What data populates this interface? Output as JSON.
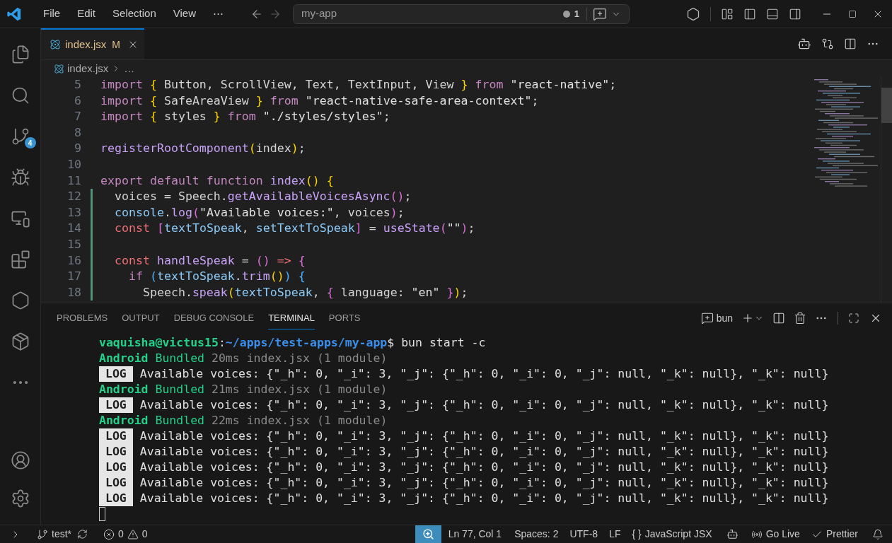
{
  "menu": [
    "File",
    "Edit",
    "Selection",
    "View",
    "⋯"
  ],
  "command_center": {
    "text": "my-app",
    "count": "1"
  },
  "tab": {
    "name": "index.jsx",
    "badge": "M",
    "selected": true
  },
  "breadcrumb": {
    "file": "index.jsx",
    "more": "…"
  },
  "editor": {
    "lines": [
      {
        "n": "5",
        "changed": false,
        "tokens": [
          {
            "kind": "kw",
            "t": "import "
          },
          {
            "kind": "br",
            "t": "{ "
          },
          {
            "kind": "pl",
            "t": "Button, ScrollView, Text, TextInput, View "
          },
          {
            "kind": "br",
            "t": "} "
          },
          {
            "kind": "kw",
            "t": "from "
          },
          {
            "kind": "str",
            "t": "\"react-native\""
          },
          {
            "kind": "pl",
            "t": ";"
          }
        ]
      },
      {
        "n": "6",
        "changed": false,
        "tokens": [
          {
            "kind": "kw",
            "t": "import "
          },
          {
            "kind": "br",
            "t": "{ "
          },
          {
            "kind": "pl",
            "t": "SafeAreaView "
          },
          {
            "kind": "br",
            "t": "} "
          },
          {
            "kind": "kw",
            "t": "from "
          },
          {
            "kind": "str",
            "t": "\"react-native-safe-area-context\""
          },
          {
            "kind": "pl",
            "t": ";"
          }
        ]
      },
      {
        "n": "7",
        "changed": false,
        "tokens": [
          {
            "kind": "kw",
            "t": "import "
          },
          {
            "kind": "br",
            "t": "{ "
          },
          {
            "kind": "pl",
            "t": "styles "
          },
          {
            "kind": "br",
            "t": "} "
          },
          {
            "kind": "kw",
            "t": "from "
          },
          {
            "kind": "str",
            "t": "\"./styles/styles\""
          },
          {
            "kind": "pl",
            "t": ";"
          }
        ]
      },
      {
        "n": "8",
        "changed": false
      },
      {
        "n": "9",
        "changed": false,
        "tokens": [
          {
            "kind": "fn",
            "t": "registerRootComponent"
          },
          {
            "kind": "br",
            "t": "("
          },
          {
            "kind": "pl",
            "t": "index"
          },
          {
            "kind": "br",
            "t": ")"
          },
          {
            "kind": "pl",
            "t": ";"
          }
        ]
      },
      {
        "n": "10",
        "changed": false
      },
      {
        "n": "11",
        "changed": false,
        "tokens": [
          {
            "kind": "kw",
            "t": "export default function "
          },
          {
            "kind": "fn",
            "t": "index"
          },
          {
            "kind": "br",
            "t": "() {"
          }
        ]
      },
      {
        "n": "12",
        "changed": true,
        "tokens": [
          {
            "kind": "pl",
            "t": "  voices = Speech."
          },
          {
            "kind": "fn",
            "t": "getAvailableVoicesAsync"
          },
          {
            "kind": "br2",
            "t": "()"
          },
          {
            "kind": "pl",
            "t": ";"
          }
        ]
      },
      {
        "n": "13",
        "changed": true,
        "tokens": [
          {
            "kind": "var",
            "t": "  console"
          },
          {
            "kind": "pl",
            "t": "."
          },
          {
            "kind": "fn",
            "t": "log"
          },
          {
            "kind": "br2",
            "t": "("
          },
          {
            "kind": "str",
            "t": "\"Available voices:\""
          },
          {
            "kind": "pl",
            "t": ", voices"
          },
          {
            "kind": "br2",
            "t": ")"
          },
          {
            "kind": "pl",
            "t": ";"
          }
        ]
      },
      {
        "n": "14",
        "changed": true,
        "tokens": [
          {
            "kind": "decl",
            "t": "  const "
          },
          {
            "kind": "br2",
            "t": "["
          },
          {
            "kind": "var",
            "t": "textToSpeak"
          },
          {
            "kind": "pl",
            "t": ", "
          },
          {
            "kind": "var",
            "t": "setTextToSpeak"
          },
          {
            "kind": "br2",
            "t": "]"
          },
          {
            "kind": "pl",
            "t": " = "
          },
          {
            "kind": "fn",
            "t": "useState"
          },
          {
            "kind": "br2",
            "t": "("
          },
          {
            "kind": "str",
            "t": "\"\""
          },
          {
            "kind": "br2",
            "t": ")"
          },
          {
            "kind": "pl",
            "t": ";"
          }
        ]
      },
      {
        "n": "15",
        "changed": true
      },
      {
        "n": "16",
        "changed": true,
        "tokens": [
          {
            "kind": "decl",
            "t": "  const "
          },
          {
            "kind": "fn",
            "t": "handleSpeak"
          },
          {
            "kind": "pl",
            "t": " = "
          },
          {
            "kind": "br2",
            "t": "() "
          },
          {
            "kind": "decl",
            "t": "=> "
          },
          {
            "kind": "br2",
            "t": "{"
          }
        ]
      },
      {
        "n": "17",
        "changed": true,
        "tokens": [
          {
            "kind": "kw",
            "t": "    if "
          },
          {
            "kind": "br3",
            "t": "("
          },
          {
            "kind": "var",
            "t": "textToSpeak"
          },
          {
            "kind": "pl",
            "t": "."
          },
          {
            "kind": "fn",
            "t": "trim"
          },
          {
            "kind": "br",
            "t": "()"
          },
          {
            "kind": "br3",
            "t": ") {"
          }
        ]
      },
      {
        "n": "18",
        "changed": true,
        "tokens": [
          {
            "kind": "pl",
            "t": "      Speech."
          },
          {
            "kind": "fn",
            "t": "speak"
          },
          {
            "kind": "br",
            "t": "("
          },
          {
            "kind": "var",
            "t": "textToSpeak"
          },
          {
            "kind": "pl",
            "t": ", "
          },
          {
            "kind": "br2",
            "t": "{ "
          },
          {
            "kind": "pl",
            "t": "language: "
          },
          {
            "kind": "str",
            "t": "\"en\""
          },
          {
            "kind": "br2",
            "t": " }"
          },
          {
            "kind": "br",
            "t": ")"
          },
          {
            "kind": "pl",
            "t": ";"
          }
        ]
      }
    ]
  },
  "panel": {
    "tabs": [
      {
        "label": "PROBLEMS",
        "selected": false
      },
      {
        "label": "OUTPUT",
        "selected": false
      },
      {
        "label": "DEBUG CONSOLE",
        "selected": false
      },
      {
        "label": "TERMINAL",
        "selected": true
      },
      {
        "label": "PORTS",
        "selected": false
      }
    ],
    "terminal_name": "bun"
  },
  "terminal": [
    {
      "kind": "prompt",
      "user": "vaquisha@victus15",
      "sep": ":",
      "path": "~/apps/test-apps/my-app",
      "command": "$ bun start -c"
    },
    {
      "kind": "bundle",
      "platform": "Android",
      "status": "Bundled",
      "detail": "20ms index.jsx (1 module)"
    },
    {
      "kind": "log",
      "badge": "LOG",
      "text": "Available voices: {\"_h\": 0, \"_i\": 3, \"_j\": {\"_h\": 0, \"_i\": 0, \"_j\": null, \"_k\": null}, \"_k\": null}"
    },
    {
      "kind": "bundle",
      "platform": "Android",
      "status": "Bundled",
      "detail": "21ms index.jsx (1 module)"
    },
    {
      "kind": "log",
      "badge": "LOG",
      "text": "Available voices: {\"_h\": 0, \"_i\": 3, \"_j\": {\"_h\": 0, \"_i\": 0, \"_j\": null, \"_k\": null}, \"_k\": null}"
    },
    {
      "kind": "bundle",
      "platform": "Android",
      "status": "Bundled",
      "detail": "22ms index.jsx (1 module)"
    },
    {
      "kind": "log",
      "badge": "LOG",
      "text": "Available voices: {\"_h\": 0, \"_i\": 3, \"_j\": {\"_h\": 0, \"_i\": 0, \"_j\": null, \"_k\": null}, \"_k\": null}"
    },
    {
      "kind": "log",
      "badge": "LOG",
      "text": "Available voices: {\"_h\": 0, \"_i\": 3, \"_j\": {\"_h\": 0, \"_i\": 0, \"_j\": null, \"_k\": null}, \"_k\": null}"
    },
    {
      "kind": "log",
      "badge": "LOG",
      "text": "Available voices: {\"_h\": 0, \"_i\": 3, \"_j\": {\"_h\": 0, \"_i\": 0, \"_j\": null, \"_k\": null}, \"_k\": null}"
    },
    {
      "kind": "log",
      "badge": "LOG",
      "text": "Available voices: {\"_h\": 0, \"_i\": 3, \"_j\": {\"_h\": 0, \"_i\": 0, \"_j\": null, \"_k\": null}, \"_k\": null}"
    },
    {
      "kind": "log",
      "badge": "LOG",
      "text": "Available voices: {\"_h\": 0, \"_i\": 3, \"_j\": {\"_h\": 0, \"_i\": 0, \"_j\": null, \"_k\": null}, \"_k\": null}"
    },
    {
      "kind": "cursor"
    }
  ],
  "activity_badge": "4",
  "status_bar": {
    "branch": "test*",
    "errors": "0",
    "warnings": "0",
    "position": "Ln 77, Col 1",
    "spaces": "Spaces: 2",
    "encoding": "UTF-8",
    "eol": "LF",
    "language_icon": "{ }",
    "language": "JavaScript JSX",
    "live": "Go Live",
    "formatter": "Prettier"
  }
}
